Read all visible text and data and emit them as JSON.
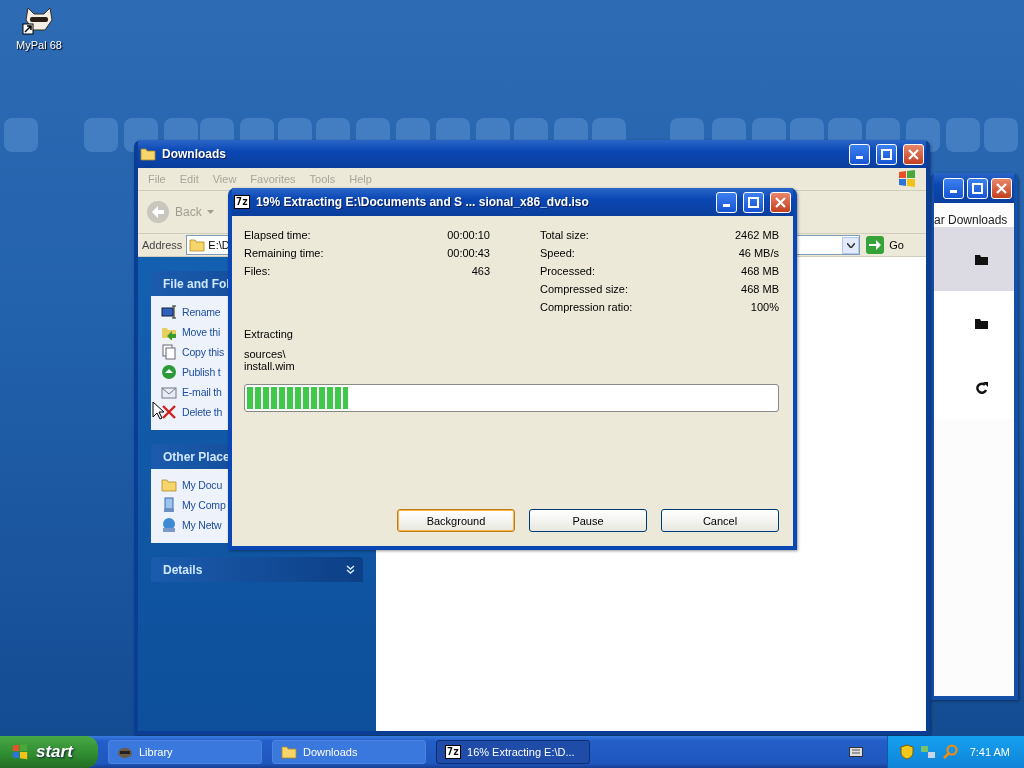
{
  "desktop": {
    "icons": [
      {
        "label": "MyPal 68"
      }
    ]
  },
  "back_window": {
    "heading": "ar Downloads",
    "rows": [
      {
        "kind": "folder",
        "selected": true
      },
      {
        "kind": "folder",
        "selected": false
      },
      {
        "kind": "refresh",
        "selected": false
      }
    ]
  },
  "explorer": {
    "title": "Downloads",
    "menu": [
      {
        "label": "File",
        "disabled": true
      },
      {
        "label": "Edit",
        "disabled": true
      },
      {
        "label": "View",
        "disabled": true
      },
      {
        "label": "Favorites",
        "disabled": true
      },
      {
        "label": "Tools",
        "disabled": true
      },
      {
        "label": "Help",
        "disabled": true
      }
    ],
    "back_button": {
      "label": "Back",
      "disabled": true
    },
    "address_label": "Address",
    "address_value": "E:\\D",
    "go_label": "Go",
    "task_panels": [
      {
        "title": "File and Fol",
        "expanded": true,
        "items": [
          {
            "label": "Rename",
            "kind": "rename"
          },
          {
            "label": "Move thi",
            "kind": "move"
          },
          {
            "label": "Copy this",
            "kind": "copy"
          },
          {
            "label": "Publish t",
            "kind": "publish"
          },
          {
            "label": "E-mail th",
            "kind": "email"
          },
          {
            "label": "Delete th",
            "kind": "delete"
          }
        ]
      },
      {
        "title": "Other Place",
        "expanded": true,
        "items": [
          {
            "label": "My Docu",
            "kind": "folder"
          },
          {
            "label": "My Comp",
            "kind": "computer"
          },
          {
            "label": "My Netw",
            "kind": "network"
          }
        ]
      },
      {
        "title": "Details",
        "expanded": false
      }
    ]
  },
  "dialog": {
    "badge": "7z",
    "title": "19% Extracting E:\\Documents and S ... sional_x86_dvd.iso",
    "left_stats": [
      {
        "label": "Elapsed time:",
        "value": "00:00:10"
      },
      {
        "label": "Remaining time:",
        "value": "00:00:43"
      },
      {
        "label": "Files:",
        "value": "463"
      }
    ],
    "right_stats": [
      {
        "label": "Total size:",
        "value": "2462 MB"
      },
      {
        "label": "Speed:",
        "value": "46 MB/s"
      },
      {
        "label": "Processed:",
        "value": "468 MB"
      },
      {
        "label": "Compressed size:",
        "value": "468 MB"
      },
      {
        "label": "Compression ratio:",
        "value": "100%"
      }
    ],
    "status": "Extracting",
    "path_lines": [
      "sources\\",
      "install.wim"
    ],
    "progress": {
      "level": 0.19
    },
    "buttons": [
      {
        "label": "Background",
        "focused": true
      },
      {
        "label": "Pause",
        "focused": false
      },
      {
        "label": "Cancel",
        "focused": false
      }
    ]
  },
  "taskbar": {
    "start_label": "start",
    "tasks": [
      {
        "label": "Library",
        "kind": "library",
        "selected": false
      },
      {
        "label": "Downloads",
        "kind": "folder",
        "selected": false
      },
      {
        "label": "16% Extracting E:\\D...",
        "kind": "badge",
        "badge": "7z",
        "selected": true
      }
    ],
    "clock": "7:41 AM"
  }
}
